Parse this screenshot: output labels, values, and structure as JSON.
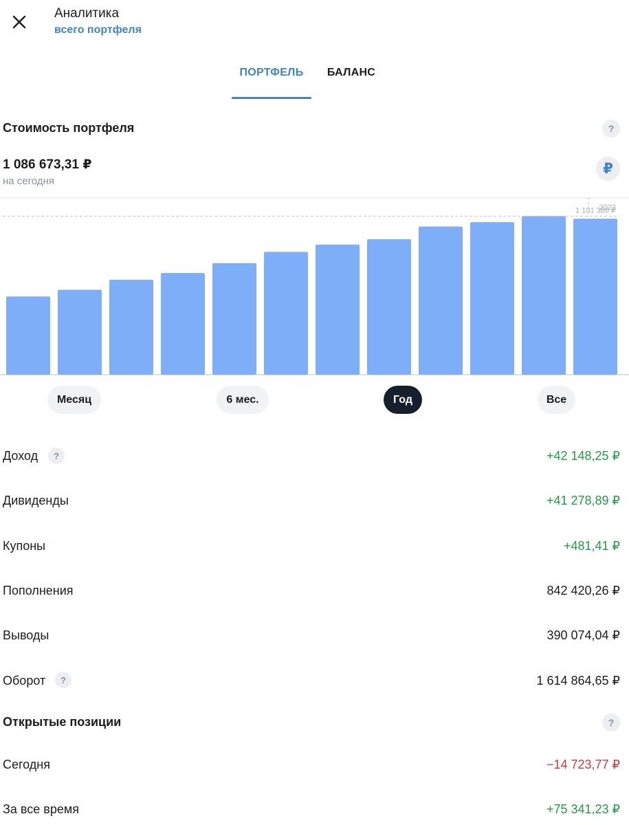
{
  "header": {
    "title": "Аналитика",
    "subtitle": "всего портфеля"
  },
  "tabs": [
    {
      "label": "ПОРТФЕЛЬ",
      "active": true
    },
    {
      "label": "БАЛАНС",
      "active": false
    }
  ],
  "portfolio": {
    "section_title": "Стоимость портфеля",
    "help": "?",
    "value": "1 086 673,31 ₽",
    "caption": "на сегодня",
    "currency_symbol": "₽"
  },
  "chart_data": {
    "type": "bar",
    "values": [
      680000,
      715000,
      768000,
      803000,
      855000,
      914000,
      952000,
      980000,
      1047000,
      1070000,
      1101386,
      1088000
    ],
    "ylim": [
      270000,
      1200000
    ],
    "bar_color": "#7eaef7",
    "highlight": {
      "year_label": "2022",
      "value_label": "1 101 386 ₽",
      "index": 10
    }
  },
  "periods": [
    {
      "label": "Месяц",
      "active": false
    },
    {
      "label": "6 мес.",
      "active": false
    },
    {
      "label": "Год",
      "active": true
    },
    {
      "label": "Все",
      "active": false
    }
  ],
  "metrics": [
    {
      "label": "Доход",
      "value": "+42 148,25 ₽",
      "tone": "pos",
      "help": true
    },
    {
      "label": "Дивиденды",
      "value": "+41 278,89 ₽",
      "tone": "pos",
      "help": false
    },
    {
      "label": "Купоны",
      "value": "+481,41 ₽",
      "tone": "pos",
      "help": false
    },
    {
      "label": "Пополнения",
      "value": "842 420,26 ₽",
      "tone": "neu",
      "help": false
    },
    {
      "label": "Выводы",
      "value": "390 074,04 ₽",
      "tone": "neu",
      "help": false
    },
    {
      "label": "Оборот",
      "value": "1 614 864,65 ₽",
      "tone": "neu",
      "help": true
    }
  ],
  "open_positions": {
    "section_title": "Открытые позиции",
    "help": "?",
    "rows": [
      {
        "label": "Сегодня",
        "value": "−14 723,77 ₽",
        "tone": "neg"
      },
      {
        "label": "За все время",
        "value": "+75 341,23 ₽",
        "tone": "pos"
      }
    ]
  },
  "colors": {
    "accent": "#3f84c9",
    "positive": "#1f9d45",
    "negative": "#d6363a",
    "chip_active": "#16202d"
  }
}
